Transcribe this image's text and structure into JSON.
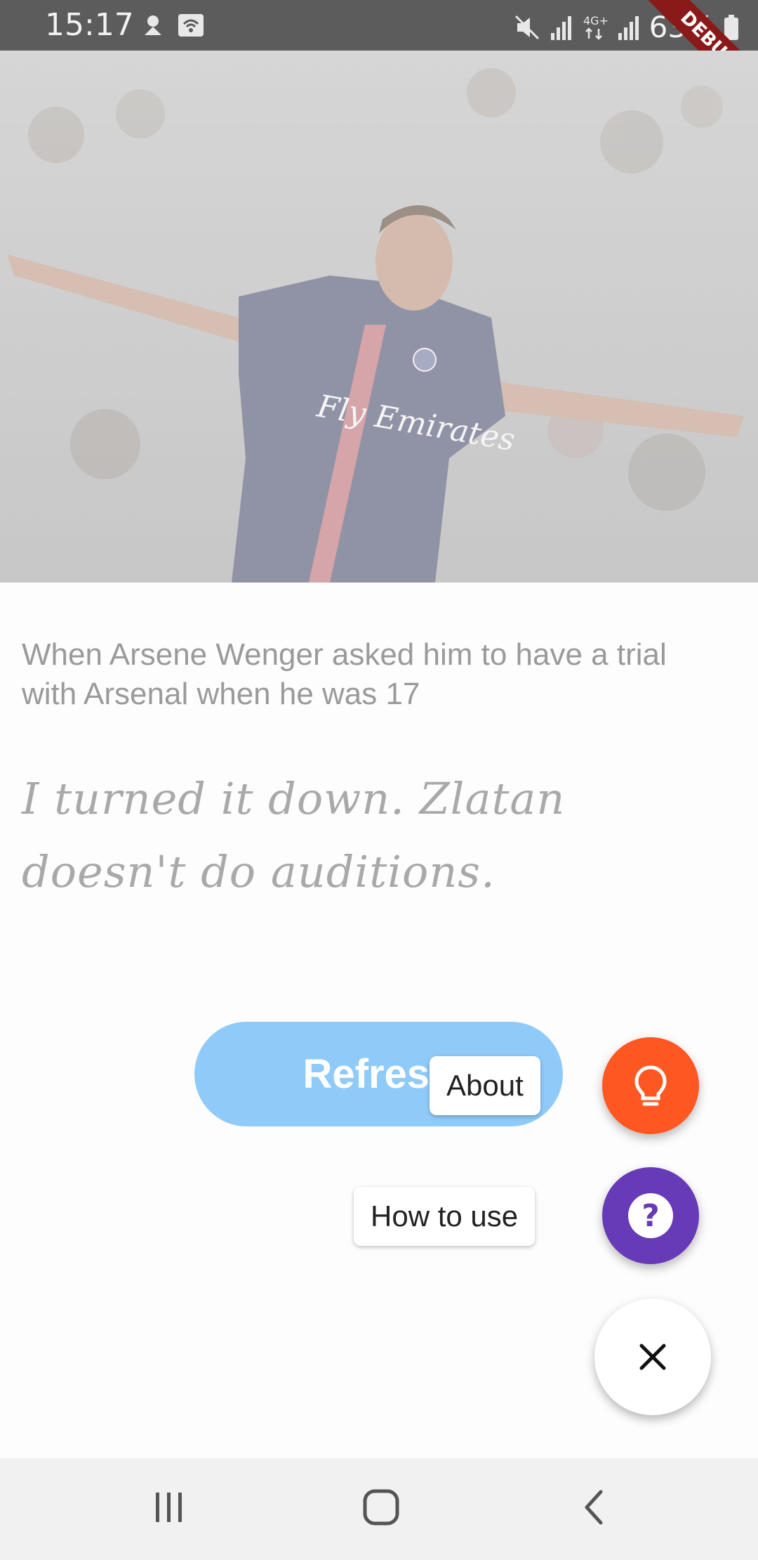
{
  "status_bar": {
    "time": "15:17",
    "battery": "63%",
    "left_icons": [
      "notification-icon",
      "wifi-icon"
    ],
    "right_icons": [
      "mute-icon",
      "signal-icon",
      "4g-icon",
      "signal-icon"
    ]
  },
  "debug_banner": "DEBUG",
  "hero": {
    "icon": "player-photo",
    "jersey_text": "Fly Emirates"
  },
  "quote": {
    "question": "When Arsene Wenger asked him to have a trial with Arsenal when he was 17",
    "answer": "I turned it down. Zlatan doesn't do auditions."
  },
  "refresh_label": "Refresh",
  "speed_dial": {
    "about_label": "About",
    "how_to_use_label": "How to use",
    "about_icon": "lightbulb-icon",
    "help_icon": "help-icon",
    "close_icon": "close-icon",
    "about_color": "#ff5722",
    "help_color": "#673ab7"
  },
  "nav_bar": {
    "icons": [
      "recents-icon",
      "home-icon",
      "back-icon"
    ]
  },
  "colors": {
    "refresh_button": "#90caf9",
    "status_bar": "#5c5c5c",
    "nav_bar": "#f1f1f1"
  }
}
